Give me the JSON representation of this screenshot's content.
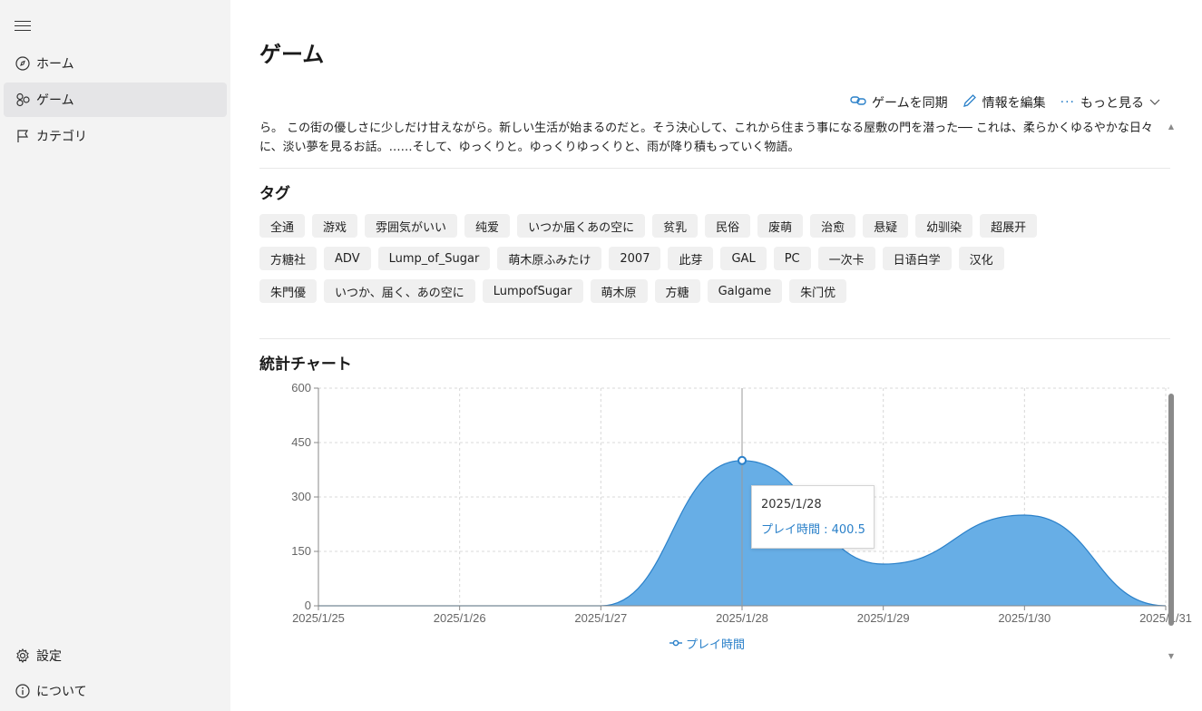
{
  "sidebar": {
    "items": [
      {
        "label": "ホーム",
        "icon": "compass-icon"
      },
      {
        "label": "ゲーム",
        "icon": "games-icon"
      },
      {
        "label": "カテゴリ",
        "icon": "flag-icon"
      }
    ],
    "footer": [
      {
        "label": "設定",
        "icon": "gear-icon"
      },
      {
        "label": "について",
        "icon": "info-icon"
      }
    ]
  },
  "page": {
    "title": "ゲーム",
    "commands": {
      "sync": "ゲームを同期",
      "edit": "情報を編集",
      "more": "もっと見る"
    },
    "description": "ら。 この街の優しさに少しだけ甘えながら。新しい生活が始まるのだと。そう決心して、これから住まう事になる屋敷の門を潜った── これは、柔らかくゆるやかな日々に、淡い夢を見るお話。……そして、ゆっくりと。ゆっくりゆっくりと、雨が降り積もっていく物語。",
    "tags_title": "タグ",
    "tags": [
      [
        "全通",
        "游戏",
        "雰囲気がいい",
        "纯爱",
        "いつか届くあの空に",
        "贫乳",
        "民俗",
        "废萌",
        "治愈",
        "悬疑",
        "幼驯染",
        "超展开"
      ],
      [
        "方糖社",
        "ADV",
        "Lump_of_Sugar",
        "萌木原ふみたけ",
        "2007",
        "此芽",
        "GAL",
        "PC",
        "一次卡",
        "日语白学",
        "汉化"
      ],
      [
        "朱門優",
        "いつか、届く、あの空に",
        "LumpofSugar",
        "萌木原",
        "方糖",
        "Galgame",
        "朱门优"
      ]
    ],
    "chart_title": "統計チャート"
  },
  "chart_data": {
    "type": "area",
    "x": [
      "2025/1/25",
      "2025/1/26",
      "2025/1/27",
      "2025/1/28",
      "2025/1/29",
      "2025/1/30",
      "2025/1/31"
    ],
    "series": [
      {
        "name": "プレイ時間",
        "values": [
          0,
          0,
          0,
          400.5,
          115,
          250,
          0
        ]
      }
    ],
    "yticks": [
      "0",
      "150",
      "300",
      "450",
      "600"
    ],
    "ylim": [
      0,
      600
    ],
    "grid": true,
    "legend": "bottom-center",
    "tooltip": {
      "date": "2025/1/28",
      "text": "プレイ時間 : 400.5"
    },
    "colors": {
      "fill": "#67aee6",
      "line": "#2a80c9"
    }
  }
}
